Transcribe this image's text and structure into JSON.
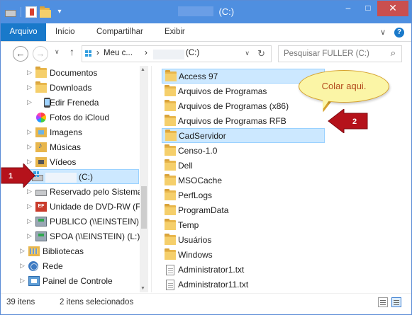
{
  "window": {
    "title_suffix": "(C:)",
    "minimize": "–",
    "maximize": "□",
    "close": "✕"
  },
  "ribbon": {
    "tabs": [
      "Arquivo",
      "Início",
      "Compartilhar",
      "Exibir"
    ],
    "collapse_glyph": "∨",
    "help_glyph": "?"
  },
  "address": {
    "back": "←",
    "forward": "→",
    "recent": "∨",
    "up": "↑",
    "crumb_1": "Meu c...",
    "sep": "›",
    "crumb_2_suffix": "(C:)",
    "dropdown": "∨",
    "refresh": "↻"
  },
  "search": {
    "placeholder": "Pesquisar FULLER (C:)",
    "icon": "⌕"
  },
  "nav": {
    "items": [
      {
        "label": "Documentos",
        "icon": "folder-icon"
      },
      {
        "label": "Downloads",
        "icon": "folder-icon"
      },
      {
        "label": "Edir Freneda",
        "icon": "phone-icon"
      },
      {
        "label": "Fotos do iCloud",
        "icon": "photos-icon"
      },
      {
        "label": "Imagens",
        "icon": "pictures-folder-icon"
      },
      {
        "label": "Músicas",
        "icon": "music-folder-icon"
      },
      {
        "label": "Vídeos",
        "icon": "videos-folder-icon"
      },
      {
        "label": "(C:)",
        "icon": "drive-icon"
      },
      {
        "label": "Reservado pelo Sistema",
        "icon": "drive-icon"
      },
      {
        "label": "Unidade de DVD-RW (F:",
        "icon": "dvd-icon"
      },
      {
        "label": "PUBLICO (\\\\EINSTEIN) (",
        "icon": "network-drive-icon"
      },
      {
        "label": "SPOA (\\\\EINSTEIN) (L:)",
        "icon": "network-drive-icon"
      },
      {
        "label": "Bibliotecas",
        "icon": "libraries-icon"
      },
      {
        "label": "Rede",
        "icon": "network-icon"
      },
      {
        "label": "Painel de Controle",
        "icon": "control-panel-icon"
      }
    ],
    "dvd_badge": "EF",
    "chevron": "▷"
  },
  "files": {
    "items": [
      {
        "label": "Access 97",
        "icon": "folder-icon"
      },
      {
        "label": "Arquivos de Programas",
        "icon": "folder-icon"
      },
      {
        "label": "Arquivos de Programas (x86)",
        "icon": "folder-icon"
      },
      {
        "label": "Arquivos de Programas RFB",
        "icon": "folder-icon"
      },
      {
        "label": "CadServidor",
        "icon": "folder-icon"
      },
      {
        "label": "Censo-1.0",
        "icon": "folder-icon"
      },
      {
        "label": "Dell",
        "icon": "folder-icon"
      },
      {
        "label": "MSOCache",
        "icon": "folder-icon"
      },
      {
        "label": "PerfLogs",
        "icon": "folder-icon"
      },
      {
        "label": "ProgramData",
        "icon": "folder-icon"
      },
      {
        "label": "Temp",
        "icon": "folder-icon"
      },
      {
        "label": "Usuários",
        "icon": "folder-icon"
      },
      {
        "label": "Windows",
        "icon": "folder-icon"
      },
      {
        "label": "Administrator1.txt",
        "icon": "text-file-icon"
      },
      {
        "label": "Administrator11.txt",
        "icon": "text-file-icon"
      }
    ]
  },
  "status": {
    "count": "39 itens",
    "selected": "2 itens selecionados"
  },
  "annotations": {
    "callout": "Colar aqui.",
    "marker_1": "1",
    "marker_2": "2"
  },
  "colors": {
    "titlebar": "#4f8fe0",
    "file_tab": "#1979ca",
    "selection": "#cce8ff",
    "close_button": "#c94f4f",
    "marker": "#b5121b",
    "callout_fill": "#fbf5a6",
    "callout_text": "#b34a1d"
  }
}
